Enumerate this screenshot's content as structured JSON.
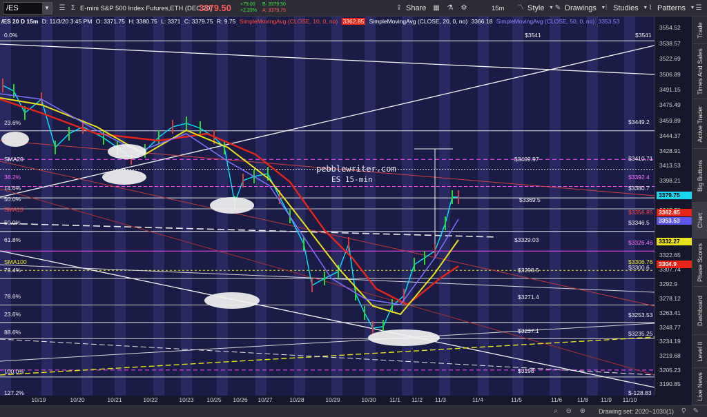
{
  "toolbar": {
    "symbol": "/ES",
    "instrument_name": "E-mini S&P 500 Index Futures,ETH (DEC 20)",
    "last_price": "3379.50",
    "change_1": "+79.00",
    "change_pct": "+2.39%",
    "bid": "B: 3379.50",
    "ask": "A: 3379.75",
    "share": "Share",
    "timeframe": "15m",
    "style": "Style",
    "drawings": "Drawings",
    "studies": "Studies",
    "patterns": "Patterns"
  },
  "info": {
    "header": "/ES 20 D 15m",
    "date": "D: 11/3/20 3:45 PM",
    "open": "O: 3371.75",
    "high": "H: 3380.75",
    "low": "L: 3371",
    "close": "C: 3379.75",
    "range": "R: 9.75",
    "sma10": "SimpleMovingAvg (CLOSE, 10, 0, no)",
    "sma10_val": "3362.85",
    "sma20": "SimpleMovingAvg (CLOSE, 20, 0, no)",
    "sma20_val": "3366.18",
    "sma50": "SimpleMovingAvg (CLOSE, 50, 0, no)",
    "sma50_val": "3353.53"
  },
  "watermark": {
    "line1": "pebblewriter.com",
    "line2": "ES 15-min"
  },
  "colors": {
    "background": "#1b1c46",
    "shade": "#2a2b63",
    "price": "#00e6ff",
    "sma10": "#e62418",
    "sma20": "#e8e21a",
    "sma50": "#7d72ff",
    "magenta": "#ff4fff",
    "yellow": "#e7e51a",
    "up": "#2ad431",
    "down": "#d63c3c"
  },
  "fib_left": [
    {
      "text": "0.0%",
      "color": "#f0f0f0"
    },
    {
      "text": "23.6%",
      "color": "#f0f0f0"
    },
    {
      "text": "SMA20",
      "color": "#ffffff"
    },
    {
      "text": "38.2%",
      "color": "#ff5fff"
    },
    {
      "text": "14.6%",
      "color": "#f0f0f0"
    },
    {
      "text": "50.0%",
      "color": "#f0f0f0"
    },
    {
      "text": "SMA10",
      "color": "#ff4444"
    },
    {
      "text": "50.0%",
      "color": "#f0f0f0"
    },
    {
      "text": "61.8%",
      "color": "#f0f0f0"
    },
    {
      "text": "SMA100",
      "color": "#f2ef2a"
    },
    {
      "text": "76.4%",
      "color": "#f0f0f0"
    },
    {
      "text": "78.6%",
      "color": "#f0f0f0"
    },
    {
      "text": "23.6%",
      "color": "#f0f0f0"
    },
    {
      "text": "88.6%",
      "color": "#f0f0f0"
    },
    {
      "text": "100.0%",
      "color": "#f0f0f0"
    },
    {
      "text": "127.2%",
      "color": "#f0f0f0"
    }
  ],
  "fib_right": [
    {
      "text": "$3541",
      "color": "#f0f0f0"
    },
    {
      "text": "$3541",
      "color": "#f0f0f0"
    },
    {
      "text": "$3449.2",
      "color": "#f0f0f0"
    },
    {
      "text": "$3409.97",
      "color": "#f0f0f0"
    },
    {
      "text": "$3410.71",
      "color": "#f0f0f0"
    },
    {
      "text": "$3392.4",
      "color": "#ff6fff"
    },
    {
      "text": "$3380.7",
      "color": "#f0f0f0"
    },
    {
      "text": "$3369.5",
      "color": "#f0f0f0"
    },
    {
      "text": "$3356.85",
      "color": "#ff4444"
    },
    {
      "text": "$3346.5",
      "color": "#f0f0f0"
    },
    {
      "text": "$3329.03",
      "color": "#f0f0f0"
    },
    {
      "text": "$3326.46",
      "color": "#ff6fff"
    },
    {
      "text": "$3306.76",
      "color": "#f2ef2a"
    },
    {
      "text": "$3300.6",
      "color": "#f0f0f0"
    },
    {
      "text": "$3298.5",
      "color": "#f0f0f0"
    },
    {
      "text": "$3271.4",
      "color": "#f0f0f0"
    },
    {
      "text": "$3253.53",
      "color": "#f0f0f0"
    },
    {
      "text": "$3237.1",
      "color": "#f0f0f0"
    },
    {
      "text": "$3235.25",
      "color": "#f0f0f0"
    },
    {
      "text": "$3198",
      "color": "#f0f0f0"
    },
    {
      "text": "$-128.83",
      "color": "#f0f0f0"
    }
  ],
  "y_axis": {
    "ticks": [
      "3554.52",
      "3538.57",
      "3522.69",
      "3506.89",
      "3491.15",
      "3475.49",
      "3459.89",
      "3444.37",
      "3428.91",
      "3413.53",
      "3398.21",
      "3382.96",
      "3367.78",
      "3337.62",
      "3322.65",
      "3307.74",
      "3292.9",
      "3278.12",
      "3263.41",
      "3248.77",
      "3234.19",
      "3219.68",
      "3205.23",
      "3190.85"
    ],
    "tags": [
      {
        "text": "3379.75",
        "bg": "#1cd6f0",
        "fg": "#000000"
      },
      {
        "text": "3362.85",
        "bg": "#e62418",
        "fg": "#ffffff"
      },
      {
        "text": "3353.53",
        "bg": "#5d56e8",
        "fg": "#ffffff"
      },
      {
        "text": "3332.27",
        "bg": "#e8e21a",
        "fg": "#000000"
      },
      {
        "text": "3304.9",
        "bg": "#e62418",
        "fg": "#ffffff"
      }
    ]
  },
  "x_axis": {
    "labels": [
      "10/19",
      "10/20",
      "10/21",
      "10/22",
      "10/23",
      "10/25",
      "10/26",
      "10/27",
      "10/28",
      "10/29",
      "10/30",
      "11/1",
      "11/2",
      "11/3",
      "11/4",
      "11/5",
      "11/6",
      "11/8",
      "11/9",
      "11/10"
    ]
  },
  "status_bar": {
    "drawing_set": "Drawing set: 2020~1030(1)"
  },
  "side_tabs": [
    "Trade",
    "Times And Sales",
    "Active Trader",
    "Big Buttons",
    "Chart",
    "Phase Scores",
    "Dashboard",
    "Level II",
    "Live News"
  ]
}
